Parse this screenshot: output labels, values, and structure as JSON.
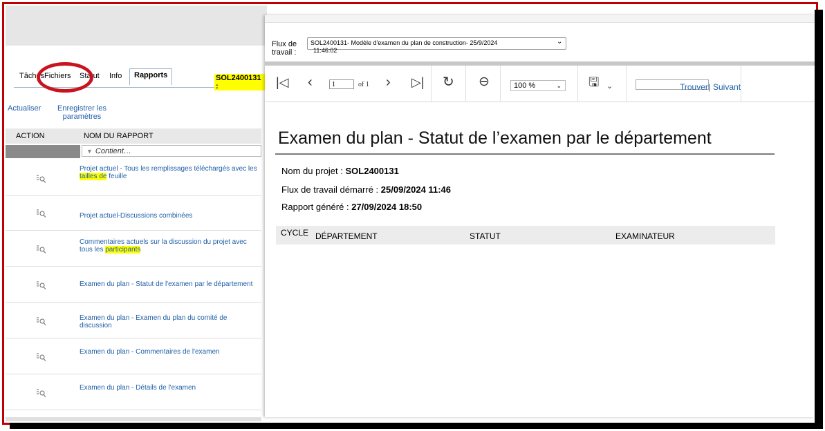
{
  "left_panel": {
    "tabs": {
      "taches": "Tâches",
      "fichiers": "Fichiers",
      "statut": "Statut",
      "info": "Info",
      "rapports": "Rapports"
    },
    "project_badge": "SOL2400131 :",
    "actions": {
      "refresh": "Actualiser",
      "save_params_1": "Enregistrer les",
      "save_params_2": "paramètres"
    },
    "columns": {
      "action": "ACTION",
      "report_name": "NOM DU RAPPORT"
    },
    "filter_placeholder": "Contient…",
    "rows": [
      {
        "pre": "Projet actuel - Tous les remplissages téléchargés avec les ",
        "hl": "tailles de",
        "post": " feuille"
      },
      {
        "pre": "Projet actuel-Discussions combinées",
        "hl": "",
        "post": ""
      },
      {
        "pre": "Commentaires actuels sur la discussion du projet avec tous les ",
        "hl": "participants",
        "post": ""
      },
      {
        "pre": "Examen du plan - Statut de l'examen par le département",
        "hl": "",
        "post": ""
      },
      {
        "pre": "Examen du plan - Examen du plan du comité de discussion",
        "hl": "",
        "post": ""
      },
      {
        "pre": "Examen du plan - Commentaires de l'examen",
        "hl": "",
        "post": ""
      },
      {
        "pre": "Examen du plan - Détails de l'examen",
        "hl": "",
        "post": ""
      }
    ]
  },
  "viewer": {
    "workflow_label_1": "Flux de",
    "workflow_label_2": "travail :",
    "workflow_value": "SOL2400131- Modèle d'examen du plan de construction- 25/9/2024",
    "workflow_time": "11:46:02",
    "toolbar": {
      "page_current": "1",
      "page_of": "of 1",
      "zoom": "100 %",
      "find": "Trouver",
      "separator": "|",
      "next": "Suivant"
    }
  },
  "report": {
    "title": "Examen du plan - Statut de l’examen par le département",
    "project_label": "Nom du projet : ",
    "project_value": "SOL2400131",
    "workflow_started_label": "Flux de travail démarré : ",
    "workflow_started_value": "25/09/2024 11:46",
    "generated_label": "Rapport généré : ",
    "generated_value": "27/09/2024 18:50",
    "table_headers": {
      "cycle": "CYCLE",
      "department": "DÉPARTEMENT",
      "status": "STATUT",
      "examiner": "EXAMINATEUR"
    }
  },
  "colors": {
    "link": "#1f5fa8",
    "highlight": "#ffff00",
    "annotation_red": "#c8141e",
    "border_red": "#c00000"
  }
}
